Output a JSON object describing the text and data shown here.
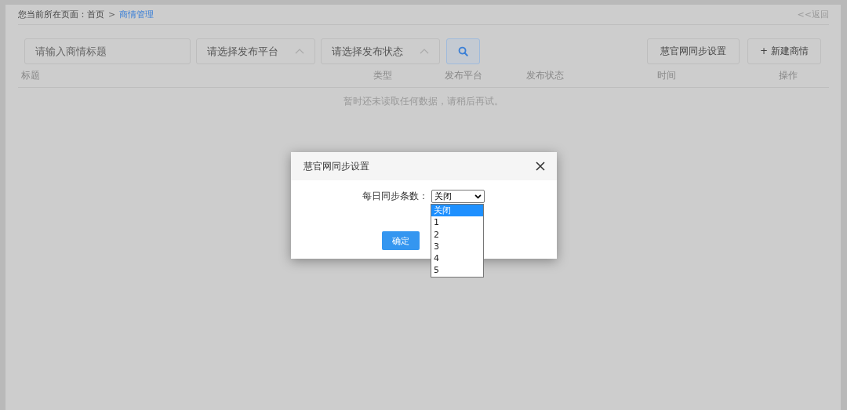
{
  "breadcrumb": {
    "label": "您当前所在页面：",
    "separator": ">",
    "items": [
      {
        "text": "首页",
        "current": false
      },
      {
        "text": "商情管理",
        "current": true
      }
    ]
  },
  "back_link": "<<返回",
  "filters": {
    "title_field": {
      "placeholder": "请输入商情标题"
    },
    "platform_select": {
      "placeholder": "请选择发布平台"
    },
    "status_select": {
      "placeholder": "请选择发布状态"
    }
  },
  "toolbar_buttons": [
    "慧官网同步设置",
    "+ 新建商情"
  ],
  "table": {
    "columns": [
      "标题",
      "类型",
      "发布平台",
      "发布状态",
      "时间",
      "操作"
    ],
    "empty_message": "暂时还未读取任何数据，请稍后再试。"
  },
  "dialog": {
    "title": "慧官网同步设置",
    "field_label": "每日同步条数：",
    "select": {
      "value": "关闭",
      "expanded": true,
      "options": [
        {
          "text": "关闭",
          "selected": true
        },
        {
          "text": "1",
          "selected": false
        },
        {
          "text": "2",
          "selected": false
        },
        {
          "text": "3",
          "selected": false
        },
        {
          "text": "4",
          "selected": false
        },
        {
          "text": "5",
          "selected": false
        }
      ]
    },
    "confirm_button": "确定"
  }
}
